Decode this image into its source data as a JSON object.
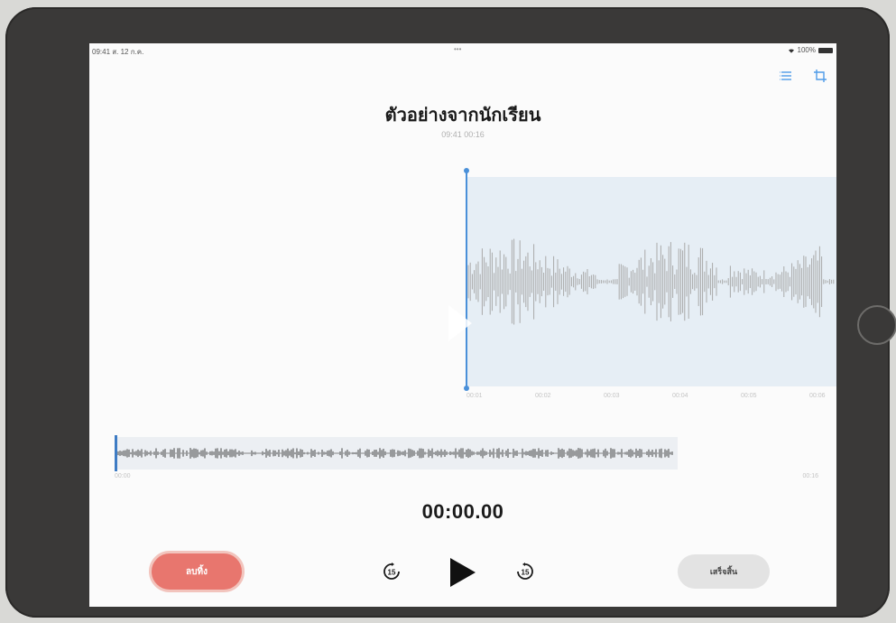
{
  "status_bar": {
    "left": "09:41  ส. 12 ก.ค.",
    "center": "•••",
    "battery": "100%"
  },
  "header": {
    "title": "ตัวอย่างจากนักเรียน",
    "subtitle": "09:41 00:16"
  },
  "top_icons": [
    "list-icon",
    "crop-icon"
  ],
  "waveform": {
    "time_ticks": [
      "00:01",
      "00:02",
      "00:03",
      "00:04",
      "00:05",
      "00:06"
    ]
  },
  "overview": {
    "start_label": "00:00",
    "end_label": "00:16"
  },
  "playback": {
    "timer": "00:00.00",
    "skip_back_label": "15",
    "skip_forward_label": "15"
  },
  "buttons": {
    "delete_label": "ลบทิ้ง",
    "done_label": "เสร็จสิ้น"
  },
  "colors": {
    "accent": "#4a90d9",
    "delete": "#e8766e",
    "wave_bg": "#e6eef5"
  }
}
